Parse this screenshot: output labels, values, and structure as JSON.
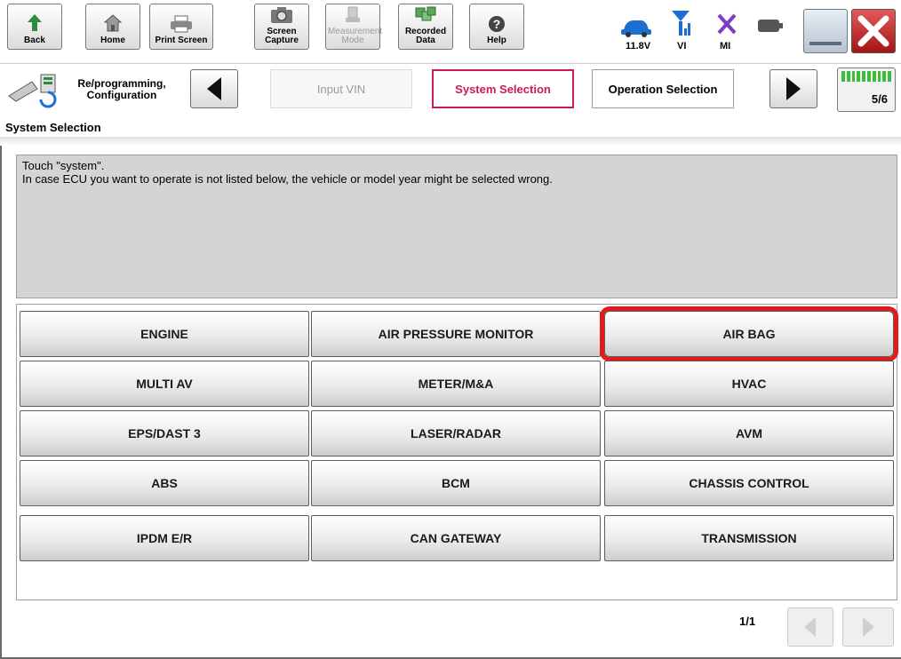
{
  "toolbar": {
    "back_label": "Back",
    "home_label": "Home",
    "print_screen_label": "Print Screen",
    "screen_capture_label": "Screen Capture",
    "measurement_mode_label": "Measurement Mode",
    "recorded_data_label": "Recorded Data",
    "help_label": "Help",
    "battery_voltage": "11.8V",
    "vi_label": "VI",
    "mi_label": "MI"
  },
  "breadcrumb": {
    "home_label": "Re/programming, Configuration",
    "steps": [
      {
        "label": "Input VIN",
        "state": "inactive"
      },
      {
        "label": "System Selection",
        "state": "active"
      },
      {
        "label": "Operation Selection",
        "state": "next"
      }
    ],
    "page_indicator": "5/6"
  },
  "section_title": "System Selection",
  "message": {
    "line1": "Touch \"system\".",
    "line2": "In case ECU you want to operate is not listed below, the vehicle or model year might be selected wrong."
  },
  "systems": [
    [
      "ENGINE",
      "AIR PRESSURE MONITOR",
      "AIR BAG"
    ],
    [
      "MULTI AV",
      "METER/M&A",
      "HVAC"
    ],
    [
      "EPS/DAST 3",
      "LASER/RADAR",
      "AVM"
    ],
    [
      "ABS",
      "BCM",
      "CHASSIS CONTROL"
    ],
    [
      "IPDM E/R",
      "CAN GATEWAY",
      "TRANSMISSION"
    ]
  ],
  "highlighted_system": "AIR BAG",
  "pager": {
    "text": "1/1"
  },
  "colors": {
    "active_step": "#cc1b4f",
    "highlight": "#e21a1a",
    "message_bg": "#d4d4d4"
  }
}
